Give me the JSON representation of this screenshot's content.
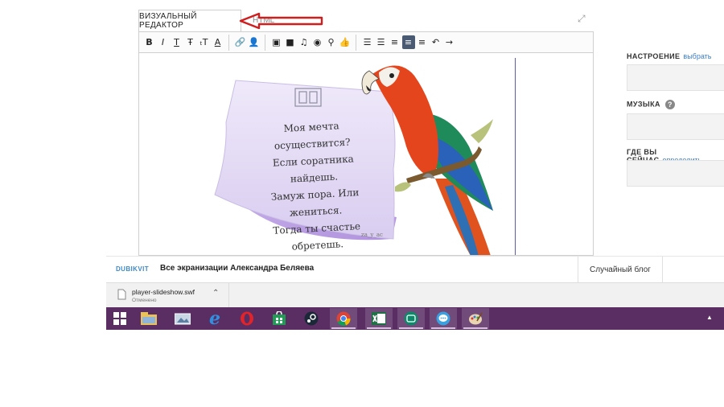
{
  "editor": {
    "tabs": [
      "ВИЗУАЛЬНЫЙ РЕДАКТОР",
      "HTML"
    ],
    "expand_icon": "⤢",
    "toolbar": [
      {
        "name": "bold-icon",
        "glyph": "B"
      },
      {
        "name": "italic-icon",
        "glyph": "I"
      },
      {
        "name": "underline-icon",
        "glyph": "T"
      },
      {
        "name": "strikethrough-icon",
        "glyph": "Ŧ"
      },
      {
        "name": "font-size-icon",
        "glyph": "ₜT"
      },
      {
        "name": "font-color-icon",
        "glyph": "A"
      },
      {
        "name": "sep"
      },
      {
        "name": "link-icon",
        "glyph": "🔗"
      },
      {
        "name": "user-icon",
        "glyph": "👤"
      },
      {
        "name": "sep"
      },
      {
        "name": "image-icon",
        "glyph": "▣"
      },
      {
        "name": "video-icon",
        "glyph": "■"
      },
      {
        "name": "music-icon",
        "glyph": "♫"
      },
      {
        "name": "spoiler-icon",
        "glyph": "◉"
      },
      {
        "name": "location-icon",
        "glyph": "⚲"
      },
      {
        "name": "like-icon",
        "glyph": "👍"
      },
      {
        "name": "sep"
      },
      {
        "name": "ordered-list-icon",
        "glyph": "☰"
      },
      {
        "name": "bullet-list-icon",
        "glyph": "☰"
      },
      {
        "name": "align-left-icon",
        "glyph": "≡"
      },
      {
        "name": "align-center-icon",
        "glyph": "≡",
        "active": true
      },
      {
        "name": "align-right-icon",
        "glyph": "≡"
      },
      {
        "name": "undo-icon",
        "glyph": "↶"
      },
      {
        "name": "redo-icon",
        "glyph": "→"
      }
    ],
    "note_lines": [
      "Моя мечта осуществится?",
      "Если соратника найдешь.",
      "Замуж пора. Или жениться.",
      "Тогда ты счастье обретешь."
    ],
    "note_signature": "za_y_ac"
  },
  "side": {
    "mood_label": "НАСТРОЕНИЕ",
    "mood_link": "выбрать",
    "music_label": "МУЗЫКА",
    "location_label": "ГДЕ ВЫ СЕЙЧАС",
    "location_link": "определить",
    "help_glyph": "?"
  },
  "pagebar": {
    "brand": "DUBIKVIT",
    "article_title": "Все экранизации Александра Беляева",
    "random_blog": "Случайный блог"
  },
  "download": {
    "filename": "player-slideshow.swf",
    "status": "Отменено"
  },
  "taskbar": {
    "apps": [
      "start-icon",
      "file-explorer-icon",
      "image-viewer-icon",
      "internet-explorer-icon",
      "opera-icon",
      "store-icon",
      "steam-icon",
      "chrome-icon",
      "excel-icon",
      "messenger-icon",
      "chat-icon",
      "paint-icon"
    ],
    "tray_up": "▲"
  },
  "colors": {
    "taskbar": "#5a2e63",
    "link": "#3b7fc4",
    "active_tool": "#4a5a73",
    "arrow": "#d01e1e",
    "note": "#e9e2f7"
  }
}
